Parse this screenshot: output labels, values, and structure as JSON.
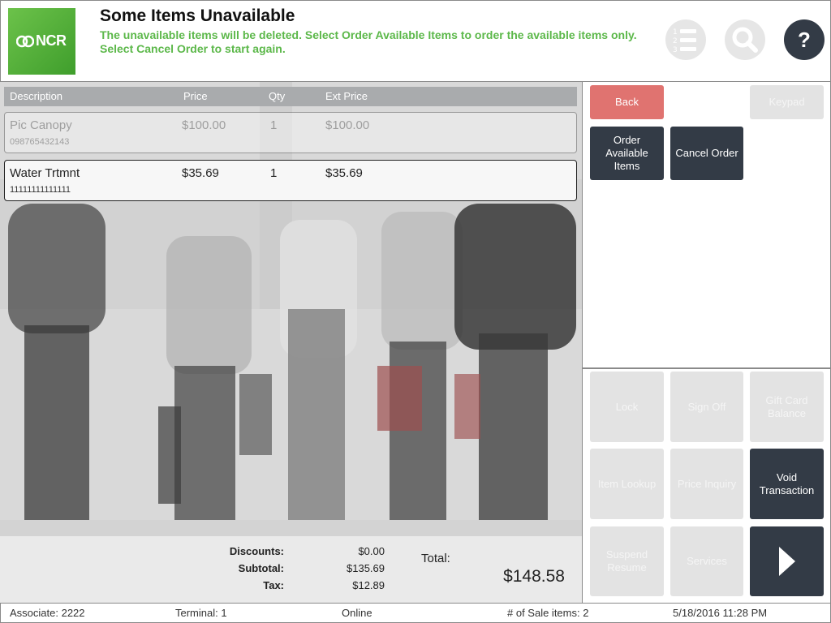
{
  "header": {
    "logo_text": "NCR",
    "title": "Some Items Unavailable",
    "message": "The unavailable items will be deleted. Select Order Available Items to order the available items only. Select Cancel Order to start again.",
    "help_label": "?"
  },
  "table": {
    "columns": [
      "Description",
      "Price",
      "Qty",
      "Ext Price"
    ],
    "rows": [
      {
        "description": "Pic Canopy",
        "price": "$100.00",
        "qty": "1",
        "ext_price": "$100.00",
        "sku": "098765432143"
      },
      {
        "description": "Water Trtmnt",
        "price": "$35.69",
        "qty": "1",
        "ext_price": "$35.69",
        "sku": "11111111111111"
      }
    ]
  },
  "totals": {
    "discounts_label": "Discounts:",
    "discounts": "$0.00",
    "subtotal_label": "Subtotal:",
    "subtotal": "$135.69",
    "tax_label": "Tax:",
    "tax": "$12.89",
    "total_label": "Total:",
    "total": "$148.58"
  },
  "actions": {
    "back": "Back",
    "keypad": "Keypad",
    "order_available": "Order Available Items",
    "cancel_order": "Cancel Order"
  },
  "functions": {
    "lock": "Lock",
    "sign_off": "Sign Off",
    "gift_card_balance": "Gift Card Balance",
    "item_lookup": "Item Lookup",
    "price_inquiry": "Price Inquiry",
    "void_transaction": "Void Transaction",
    "suspend_resume": "Suspend Resume",
    "services": "Services"
  },
  "status": {
    "associate": "Associate: 2222",
    "terminal": "Terminal: 1",
    "connection": "Online",
    "sale_items": "# of Sale items: 2",
    "datetime": "5/18/2016 11:28 PM"
  },
  "colors": {
    "accent_green": "#5cb84a",
    "dark_button": "#333b46",
    "back_button": "#e07370",
    "disabled_button": "#e3e3e3"
  }
}
